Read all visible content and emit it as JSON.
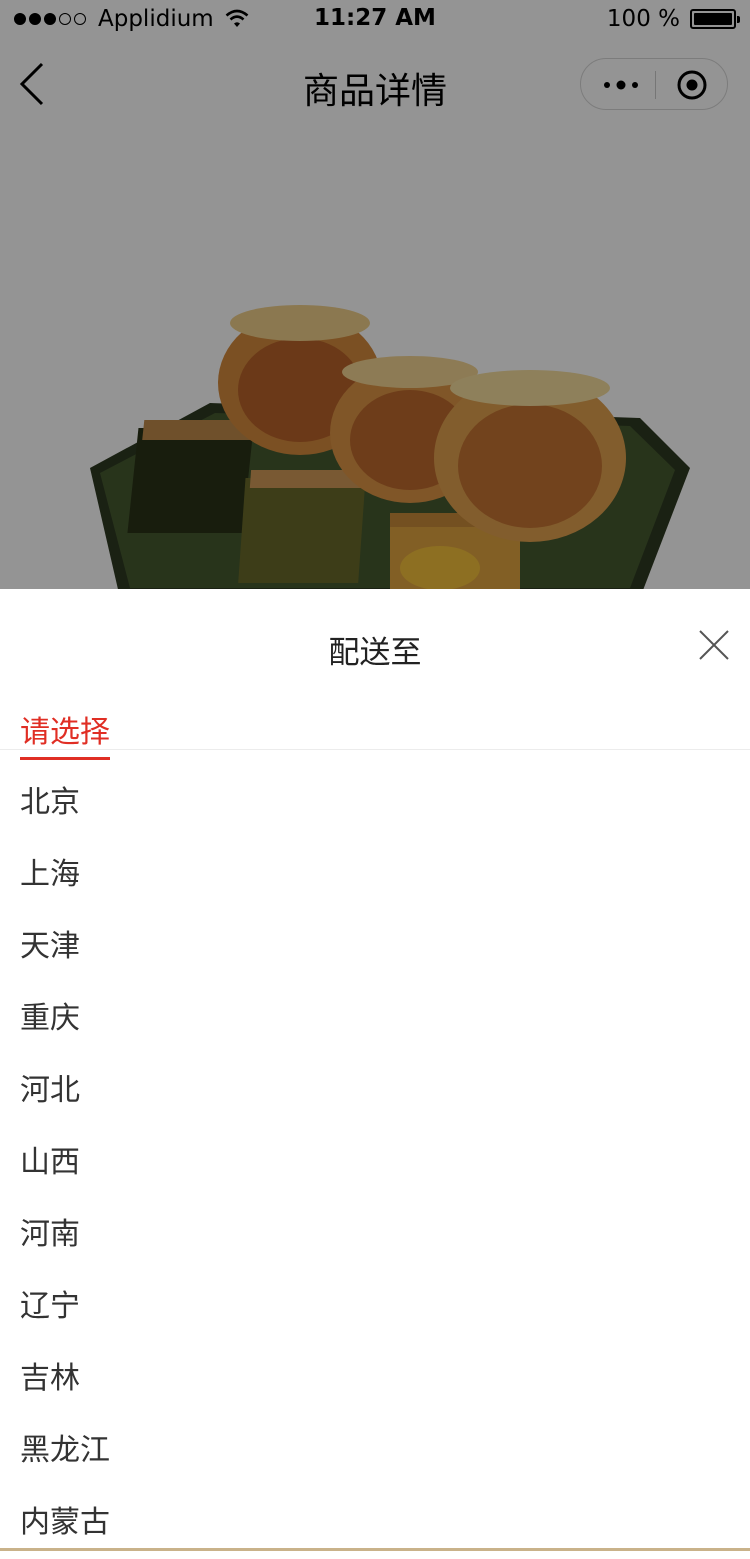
{
  "status_bar": {
    "carrier": "Applidium",
    "time": "11:27 AM",
    "battery": "100 %"
  },
  "nav": {
    "title": "商品详情",
    "back_icon": "chevron-left-icon",
    "more_icon": "more-dots-icon",
    "home_icon": "target-circle-icon"
  },
  "product": {
    "image": "mooncake-plate"
  },
  "sheet": {
    "title": "配送至",
    "close_icon": "close-icon",
    "active_tab": "请选择",
    "accent_color": "#e02e24",
    "provinces": [
      "北京",
      "上海",
      "天津",
      "重庆",
      "河北",
      "山西",
      "河南",
      "辽宁",
      "吉林",
      "黑龙江",
      "内蒙古"
    ]
  }
}
